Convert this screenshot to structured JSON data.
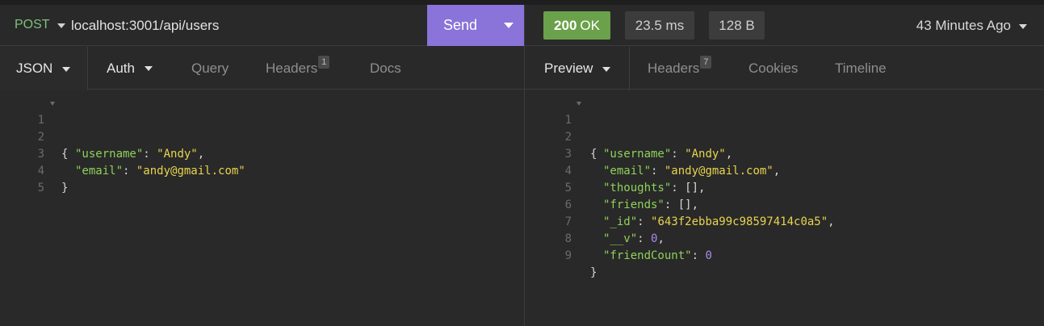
{
  "request": {
    "method": "POST",
    "url": "localhost:3001/api/users",
    "send_label": "Send",
    "tabs": [
      {
        "label": "JSON"
      },
      {
        "label": "Auth"
      },
      {
        "label": "Query"
      },
      {
        "label": "Headers",
        "badge": "1"
      },
      {
        "label": "Docs"
      }
    ],
    "line_numbers": [
      "1",
      "2",
      "3",
      "4",
      "5"
    ]
  },
  "response": {
    "status_code": "200",
    "status_text": "OK",
    "time": "23.5 ms",
    "size": "128 B",
    "history": "43 Minutes Ago",
    "tabs": [
      {
        "label": "Preview"
      },
      {
        "label": "Headers",
        "badge": "7"
      },
      {
        "label": "Cookies"
      },
      {
        "label": "Timeline"
      }
    ],
    "line_numbers": [
      "1",
      "2",
      "3",
      "4",
      "5",
      "6",
      "7",
      "8",
      "9"
    ]
  },
  "body": {
    "username_key": "\"username\"",
    "username_val": "\"Andy\"",
    "email_key": "\"email\"",
    "email_val": "\"andy@gmail.com\"",
    "thoughts_key": "\"thoughts\"",
    "thoughts_val": "[]",
    "friends_key": "\"friends\"",
    "friends_val": "[]",
    "id_key": "\"_id\"",
    "id_val": "\"643f2ebba99c98597414c0a5\"",
    "v_key": "\"__v\"",
    "v_val": "0",
    "friendcount_key": "\"friendCount\"",
    "friendcount_val": "0",
    "open_brace": "{",
    "close_brace": "}"
  },
  "colors": {
    "accent_send": "#8a73d9",
    "status_ok": "#6ba14a",
    "method_post": "#7ec17b",
    "json_key": "#8fd15a",
    "json_string": "#e8d44d",
    "json_number": "#a98be8"
  }
}
